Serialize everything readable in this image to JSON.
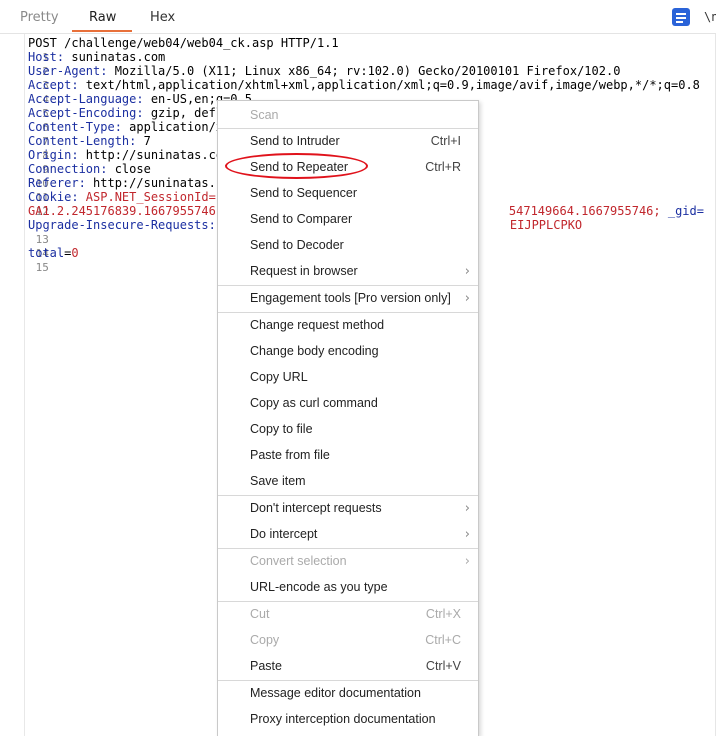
{
  "tabs": {
    "pretty": "Pretty",
    "raw": "Raw",
    "hex": "Hex",
    "newline_toggle": "\\n"
  },
  "icons": {
    "toolbar": "message-actions-icon",
    "submenu": "chevron-right-icon"
  },
  "colors": {
    "accent": "#e8703a",
    "highlight_ring": "#e0121b",
    "header_name": "#1b2fa1",
    "cookie_value": "#c1272d"
  },
  "editor": {
    "line_numbers": [
      "1",
      "2",
      "3",
      "4",
      "5",
      "6",
      "7",
      "8",
      "9",
      "10",
      "11",
      "12",
      "",
      "13",
      "14",
      "15"
    ],
    "l1": "POST /challenge/web04/web04_ck.asp HTTP/1.1",
    "l2_name": "Host:",
    "l2_val": " suninatas.com",
    "l3_name": "User-Agent:",
    "l3_val": " Mozilla/5.0 (X11; Linux x86_64; rv:102.0) Gecko/20100101 Firefox/102.0",
    "l4_name": "Accept:",
    "l4_val": " text/html,application/xhtml+xml,application/xml;q=0.9,image/avif,image/webp,*/*;q=0.8",
    "l5_name": "Accept-Language:",
    "l5_val": " en-US,en;q=0.5",
    "l6_name": "Accept-Encoding:",
    "l6_val": " gzip, defl",
    "l7_name": "Content-Type:",
    "l7_val": " application/x",
    "l8_name": "Content-Length:",
    "l8_val": " 7",
    "l9_name": "Origin:",
    "l9_val": " http://suninatas.co",
    "l10_name": "Connection:",
    "l10_val": " close",
    "l11_name": "Referer:",
    "l11_val": " http://suninatas.c",
    "l12_name": "Cookie:",
    "l12_cookie_start": " ASP.NET_SessionId=p",
    "l12_tail_a": "547149664.1667955746;",
    "l12_tail_b": " _gid=",
    "l12b_start": "GA1.2.245176839.1667955746;",
    "l12b_tail": "EIJPPLCPKO",
    "l13_name": "Upgrade-Insecure-Requests:",
    "l15_name": "total",
    "l15_eq": "=",
    "l15_val": "0"
  },
  "menu": {
    "scan": "Scan",
    "send_intruder": "Send to Intruder",
    "send_intruder_sc": "Ctrl+I",
    "send_repeater": "Send to Repeater",
    "send_repeater_sc": "Ctrl+R",
    "send_sequencer": "Send to Sequencer",
    "send_comparer": "Send to Comparer",
    "send_decoder": "Send to Decoder",
    "request_browser": "Request in browser",
    "engagement_tools": "Engagement tools [Pro version only]",
    "change_method": "Change request method",
    "change_encoding": "Change body encoding",
    "copy_url": "Copy URL",
    "copy_curl": "Copy as curl command",
    "copy_file": "Copy to file",
    "paste_file": "Paste from file",
    "save_item": "Save item",
    "dont_intercept": "Don't intercept requests",
    "do_intercept": "Do intercept",
    "convert_selection": "Convert selection",
    "url_encode": "URL-encode as you type",
    "cut": "Cut",
    "cut_sc": "Ctrl+X",
    "copy": "Copy",
    "copy_sc": "Ctrl+C",
    "paste": "Paste",
    "paste_sc": "Ctrl+V",
    "msg_editor_doc": "Message editor documentation",
    "proxy_doc": "Proxy interception documentation",
    "submenu_arrow": "›"
  }
}
